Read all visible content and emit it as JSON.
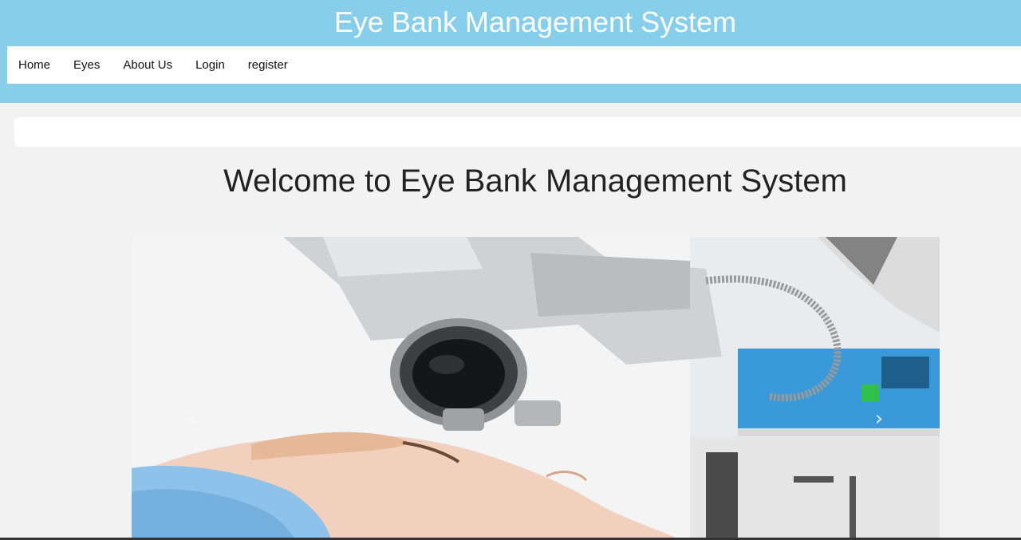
{
  "header": {
    "title": "Eye Bank Management System",
    "background_color": "#87ceeb"
  },
  "nav": {
    "items": [
      {
        "label": "Home"
      },
      {
        "label": "Eyes"
      },
      {
        "label": "About Us"
      },
      {
        "label": "Login"
      },
      {
        "label": "register"
      }
    ]
  },
  "main": {
    "heading": "Welcome to Eye Bank Management System"
  },
  "carousel": {
    "image_alt": "eye-exam-photo",
    "prev_icon": "chevron-left-icon",
    "next_icon": "chevron-right-icon",
    "prev_glyph": "‹",
    "next_glyph": "›"
  }
}
